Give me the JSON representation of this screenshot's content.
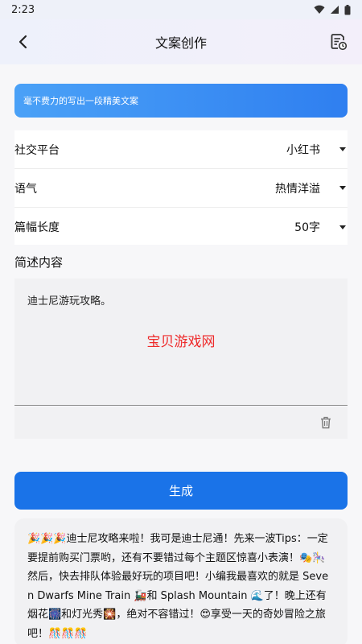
{
  "status_bar": {
    "time": "2:23"
  },
  "app_bar": {
    "title": "文案创作"
  },
  "banner": {
    "text": "毫不费力的写出一段精美文案"
  },
  "form": {
    "rows": [
      {
        "label": "社交平台",
        "value": "小红书"
      },
      {
        "label": "语气",
        "value": "热情洋溢"
      },
      {
        "label": "篇幅长度",
        "value": "50字"
      }
    ]
  },
  "description": {
    "section_title": "简述内容",
    "input_value": "迪士尼游玩攻略。",
    "watermark": "宝贝游戏网"
  },
  "generate_button": {
    "label": "生成"
  },
  "result": {
    "text": "🎉🎉🎉迪士尼攻略来啦！我可是迪士尼通！先来一波Tips：一定要提前购买门票哟，还有不要错过每个主题区惊喜小表演！🎭🎠 然后，快去排队体验最好玩的项目吧！小编我最喜欢的就是 Seven Dwarfs Mine Train 🚂和 Splash Mountain 🌊了！晚上还有烟花🎆和灯光秀🎇，绝对不容错过！😍享受一天的奇妙冒险之旅吧！🎊🎊🎊"
  },
  "colors": {
    "accent": "#1a73e8",
    "watermark": "#ee2b2b"
  }
}
